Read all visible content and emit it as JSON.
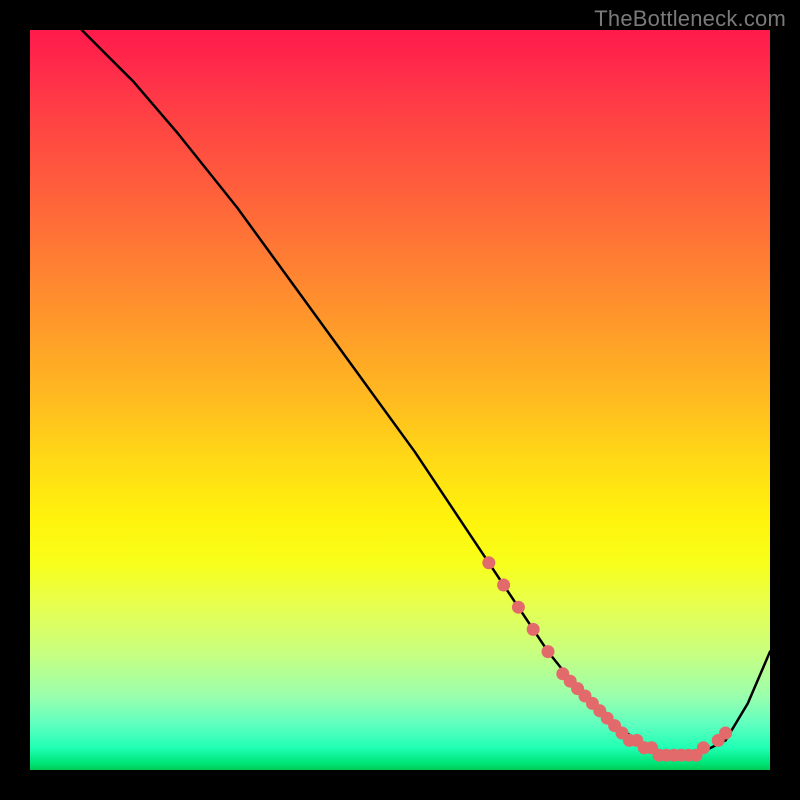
{
  "attribution": "TheBottleneck.com",
  "chart_data": {
    "type": "line",
    "title": "",
    "xlabel": "",
    "ylabel": "",
    "xlim": [
      0,
      100
    ],
    "ylim": [
      0,
      100
    ],
    "series": [
      {
        "name": "curve",
        "x": [
          7,
          10,
          14,
          20,
          28,
          36,
          44,
          52,
          58,
          62,
          66,
          70,
          74,
          78,
          82,
          86,
          90,
          94,
          97,
          100
        ],
        "y": [
          100,
          97,
          93,
          86,
          76,
          65,
          54,
          43,
          34,
          28,
          22,
          16,
          11,
          7,
          4,
          2,
          2,
          4,
          9,
          16
        ]
      }
    ],
    "markers": [
      {
        "x": 62,
        "y": 28
      },
      {
        "x": 64,
        "y": 25
      },
      {
        "x": 66,
        "y": 22
      },
      {
        "x": 68,
        "y": 19
      },
      {
        "x": 70,
        "y": 16
      },
      {
        "x": 72,
        "y": 13
      },
      {
        "x": 73,
        "y": 12
      },
      {
        "x": 74,
        "y": 11
      },
      {
        "x": 75,
        "y": 10
      },
      {
        "x": 76,
        "y": 9
      },
      {
        "x": 77,
        "y": 8
      },
      {
        "x": 78,
        "y": 7
      },
      {
        "x": 79,
        "y": 6
      },
      {
        "x": 80,
        "y": 5
      },
      {
        "x": 81,
        "y": 4
      },
      {
        "x": 82,
        "y": 4
      },
      {
        "x": 83,
        "y": 3
      },
      {
        "x": 84,
        "y": 3
      },
      {
        "x": 85,
        "y": 2
      },
      {
        "x": 86,
        "y": 2
      },
      {
        "x": 87,
        "y": 2
      },
      {
        "x": 88,
        "y": 2
      },
      {
        "x": 89,
        "y": 2
      },
      {
        "x": 90,
        "y": 2
      },
      {
        "x": 91,
        "y": 3
      },
      {
        "x": 93,
        "y": 4
      },
      {
        "x": 94,
        "y": 5
      }
    ],
    "colors": {
      "line": "#000000",
      "marker": "#e26a6a"
    }
  }
}
